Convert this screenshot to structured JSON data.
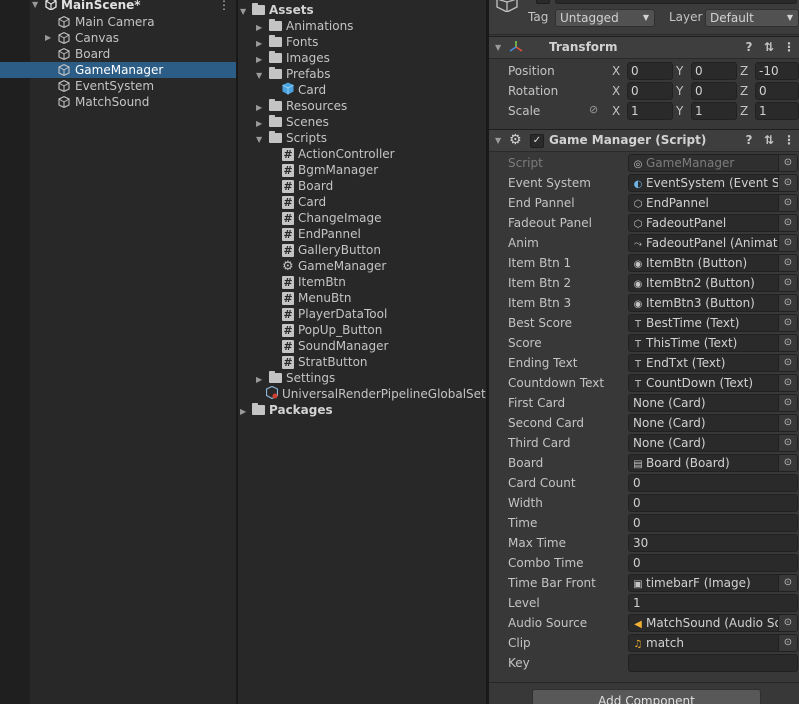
{
  "hierarchy": {
    "scene_name": "MainScene*",
    "items": [
      {
        "label": "Main Camera",
        "expandable": false,
        "selected": false
      },
      {
        "label": "Canvas",
        "expandable": true,
        "selected": false
      },
      {
        "label": "Board",
        "expandable": false,
        "selected": false
      },
      {
        "label": "GameManager",
        "expandable": false,
        "selected": true
      },
      {
        "label": "EventSystem",
        "expandable": false,
        "selected": false
      },
      {
        "label": "MatchSound",
        "expandable": false,
        "selected": false
      }
    ]
  },
  "project": {
    "assets_label": "Assets",
    "packages_label": "Packages",
    "tree": [
      {
        "label": "Animations",
        "type": "folder",
        "depth": 1,
        "expanded": false
      },
      {
        "label": "Fonts",
        "type": "folder",
        "depth": 1,
        "expanded": false
      },
      {
        "label": "Images",
        "type": "folder",
        "depth": 1,
        "expanded": false
      },
      {
        "label": "Prefabs",
        "type": "folder",
        "depth": 1,
        "expanded": true
      },
      {
        "label": "Card",
        "type": "prefab",
        "depth": 2
      },
      {
        "label": "Resources",
        "type": "folder",
        "depth": 1,
        "expanded": false
      },
      {
        "label": "Scenes",
        "type": "folder",
        "depth": 1,
        "expanded": false
      },
      {
        "label": "Scripts",
        "type": "folder",
        "depth": 1,
        "expanded": true
      },
      {
        "label": "ActionController",
        "type": "script",
        "depth": 2
      },
      {
        "label": "BgmManager",
        "type": "script",
        "depth": 2
      },
      {
        "label": "Board",
        "type": "script",
        "depth": 2
      },
      {
        "label": "Card",
        "type": "script",
        "depth": 2
      },
      {
        "label": "ChangeImage",
        "type": "script",
        "depth": 2
      },
      {
        "label": "EndPannel",
        "type": "script",
        "depth": 2
      },
      {
        "label": "GalleryButton",
        "type": "script",
        "depth": 2
      },
      {
        "label": "GameManager",
        "type": "gear",
        "depth": 2
      },
      {
        "label": "ItemBtn",
        "type": "script",
        "depth": 2
      },
      {
        "label": "MenuBtn",
        "type": "script",
        "depth": 2
      },
      {
        "label": "PlayerDataTool",
        "type": "script",
        "depth": 2
      },
      {
        "label": "PopUp_Button",
        "type": "script",
        "depth": 2
      },
      {
        "label": "SoundManager",
        "type": "script",
        "depth": 2
      },
      {
        "label": "StratButton",
        "type": "script",
        "depth": 2
      },
      {
        "label": "Settings",
        "type": "folder",
        "depth": 1,
        "expanded": false
      },
      {
        "label": "UniversalRenderPipelineGlobalSetti",
        "type": "asset",
        "depth": 1
      }
    ]
  },
  "inspector": {
    "tag_label": "Tag",
    "tag_value": "Untagged",
    "layer_label": "Layer",
    "layer_value": "Default",
    "transform": {
      "title": "Transform",
      "rows": [
        {
          "label": "Position",
          "x": "0",
          "y": "0",
          "z": "-10"
        },
        {
          "label": "Rotation",
          "x": "0",
          "y": "0",
          "z": "0"
        },
        {
          "label": "Scale",
          "x": "1",
          "y": "1",
          "z": "1"
        }
      ]
    },
    "game_manager": {
      "title": "Game Manager (Script)",
      "fields": [
        {
          "label": "Script",
          "value": "GameManager",
          "kind": "object",
          "icon": "script-icon",
          "disabled": true
        },
        {
          "label": "Event System",
          "value": "EventSystem (Event Sys",
          "kind": "object",
          "icon": "eventsystem-icon"
        },
        {
          "label": "End Pannel",
          "value": "EndPannel",
          "kind": "object",
          "icon": "gameobject-icon"
        },
        {
          "label": "Fadeout Panel",
          "value": "FadeoutPanel",
          "kind": "object",
          "icon": "gameobject-icon"
        },
        {
          "label": "Anim",
          "value": "FadeoutPanel (Animato",
          "kind": "object",
          "icon": "animator-icon"
        },
        {
          "label": "Item Btn 1",
          "value": "ItemBtn (Button)",
          "kind": "object",
          "icon": "button-icon"
        },
        {
          "label": "Item Btn 2",
          "value": "ItemBtn2 (Button)",
          "kind": "object",
          "icon": "button-icon"
        },
        {
          "label": "Item Btn 3",
          "value": "ItemBtn3 (Button)",
          "kind": "object",
          "icon": "button-icon"
        },
        {
          "label": "Best Score",
          "value": "BestTime (Text)",
          "kind": "object",
          "icon": "text-icon"
        },
        {
          "label": "Score",
          "value": "ThisTime (Text)",
          "kind": "object",
          "icon": "text-icon"
        },
        {
          "label": "Ending Text",
          "value": "EndTxt (Text)",
          "kind": "object",
          "icon": "text-icon"
        },
        {
          "label": "Countdown Text",
          "value": "CountDown (Text)",
          "kind": "object",
          "icon": "text-icon"
        },
        {
          "label": "First Card",
          "value": "None (Card)",
          "kind": "object",
          "icon": ""
        },
        {
          "label": "Second Card",
          "value": "None (Card)",
          "kind": "object",
          "icon": ""
        },
        {
          "label": "Third Card",
          "value": "None (Card)",
          "kind": "object",
          "icon": ""
        },
        {
          "label": "Board",
          "value": "Board (Board)",
          "kind": "object",
          "icon": "script-file-icon"
        },
        {
          "label": "Card Count",
          "value": "0",
          "kind": "number"
        },
        {
          "label": "Width",
          "value": "0",
          "kind": "number"
        },
        {
          "label": "Time",
          "value": "0",
          "kind": "number"
        },
        {
          "label": "Max Time",
          "value": "30",
          "kind": "number"
        },
        {
          "label": "Combo Time",
          "value": "0",
          "kind": "number"
        },
        {
          "label": "Time Bar Front",
          "value": "timebarF (Image)",
          "kind": "object",
          "icon": "image-icon"
        },
        {
          "label": "Level",
          "value": "1",
          "kind": "number"
        },
        {
          "label": "Audio Source",
          "value": "MatchSound (Audio Sou",
          "kind": "object",
          "icon": "audio-source-icon"
        },
        {
          "label": "Clip",
          "value": "match",
          "kind": "object",
          "icon": "audio-clip-icon"
        },
        {
          "label": "Key",
          "value": "",
          "kind": "number"
        }
      ]
    },
    "add_component_label": "Add Component"
  },
  "colors": {
    "selection": "#2c5d87",
    "panel_dark": "#282828",
    "inspector_bg": "#383838",
    "field_bg": "#2a2a2a"
  }
}
